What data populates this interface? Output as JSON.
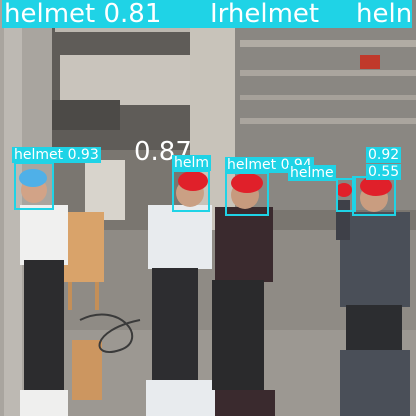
{
  "image": {
    "kind": "object detection output on construction site photo",
    "accent_color": "#1fd3e6"
  },
  "top_labels": [
    "helmet 0.81",
    "Irhelmet",
    "heln"
  ],
  "mid_fragment": "0.87",
  "detections": [
    {
      "label": "helmet 0.93",
      "class": "helmet",
      "confidence": 0.93
    },
    {
      "label": "helm",
      "class": "helmet"
    },
    {
      "label": "helmet 0.94",
      "class": "helmet",
      "confidence": 0.94
    },
    {
      "label": "0.92",
      "confidence": 0.92
    },
    {
      "label": "helme",
      "class": "helmet"
    },
    {
      "label": "0.55",
      "confidence": 0.55
    }
  ]
}
